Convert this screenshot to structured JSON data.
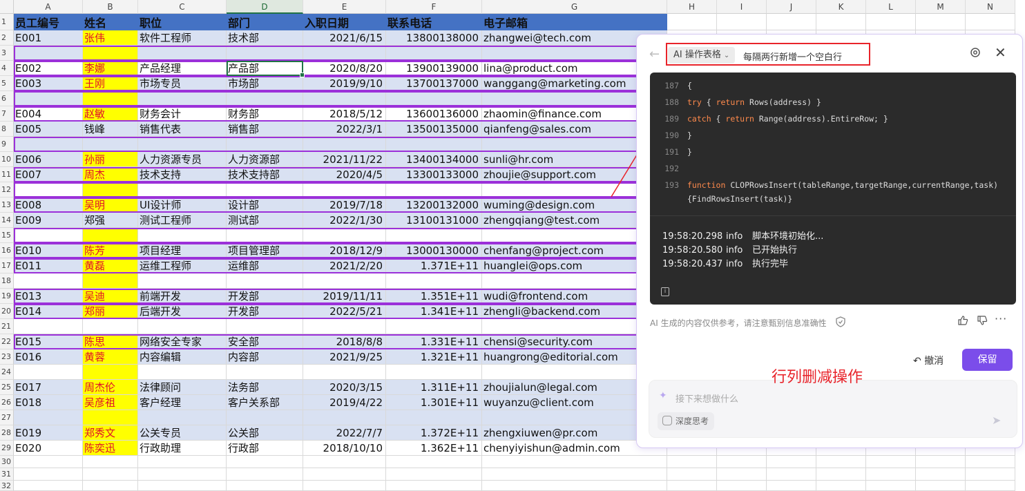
{
  "columns": [
    "A",
    "B",
    "C",
    "D",
    "E",
    "F",
    "G",
    "H",
    "I",
    "J",
    "K",
    "L",
    "M",
    "N"
  ],
  "row_numbers": [
    "1",
    "2",
    "3",
    "4",
    "5",
    "6",
    "7",
    "8",
    "9",
    "10",
    "11",
    "12",
    "13",
    "14",
    "15",
    "16",
    "17",
    "18",
    "19",
    "20",
    "21",
    "22",
    "23",
    "24",
    "25",
    "26",
    "27",
    "28",
    "29",
    "30",
    "31",
    "32"
  ],
  "table": {
    "headers": [
      "员工编号",
      "姓名",
      "职位",
      "部门",
      "入职日期",
      "联系电话",
      "电子邮箱"
    ],
    "rows": [
      [
        "E001",
        "张伟",
        "软件工程师",
        "技术部",
        "2021/6/15",
        "13800138000",
        "zhangwei@tech.com"
      ],
      [
        "",
        "",
        "",
        "",
        "",
        "",
        ""
      ],
      [
        "E002",
        "李娜",
        "产品经理",
        "产品部",
        "2020/8/20",
        "13900139000",
        "lina@product.com"
      ],
      [
        "E003",
        "王刚",
        "市场专员",
        "市场部",
        "2019/9/10",
        "13700137000",
        "wanggang@marketing.com"
      ],
      [
        "",
        "",
        "",
        "",
        "",
        "",
        ""
      ],
      [
        "E004",
        "赵敏",
        "财务会计",
        "财务部",
        "2018/5/12",
        "13600136000",
        "zhaomin@finance.com"
      ],
      [
        "E005",
        "钱峰",
        "销售代表",
        "销售部",
        "2022/3/1",
        "13500135000",
        "qianfeng@sales.com"
      ],
      [
        "",
        "",
        "",
        "",
        "",
        "",
        ""
      ],
      [
        "E006",
        "孙丽",
        "人力资源专员",
        "人力资源部",
        "2021/11/22",
        "13400134000",
        "sunli@hr.com"
      ],
      [
        "E007",
        "周杰",
        "技术支持",
        "技术支持部",
        "2020/4/5",
        "13300133000",
        "zhoujie@support.com"
      ],
      [
        "",
        "",
        "",
        "",
        "",
        "",
        ""
      ],
      [
        "E008",
        "吴明",
        "UI设计师",
        "设计部",
        "2019/7/18",
        "13200132000",
        "wuming@design.com"
      ],
      [
        "E009",
        "郑强",
        "测试工程师",
        "测试部",
        "2022/1/30",
        "13100131000",
        "zhengqiang@test.com"
      ],
      [
        "",
        "",
        "",
        "",
        "",
        "",
        ""
      ],
      [
        "E010",
        "陈芳",
        "项目经理",
        "项目管理部",
        "2018/12/9",
        "13000130000",
        "chenfang@project.com"
      ],
      [
        "E011",
        "黄磊",
        "运维工程师",
        "运维部",
        "2021/2/20",
        "1.371E+11",
        "huanglei@ops.com"
      ],
      [
        "",
        "",
        "",
        "",
        "",
        "",
        ""
      ],
      [
        "E013",
        "吴迪",
        "前端开发",
        "开发部",
        "2019/11/11",
        "1.351E+11",
        "wudi@frontend.com"
      ],
      [
        "E014",
        "郑丽",
        "后端开发",
        "开发部",
        "2022/5/21",
        "1.341E+11",
        "zhengli@backend.com"
      ],
      [
        "",
        "",
        "",
        "",
        "",
        "",
        ""
      ],
      [
        "E015",
        "陈思",
        "网络安全专家",
        "安全部",
        "2018/8/8",
        "1.331E+11",
        "chensi@security.com"
      ],
      [
        "E016",
        "黄蓉",
        "内容编辑",
        "内容部",
        "2021/9/25",
        "1.321E+11",
        "huangrong@editorial.com"
      ],
      [
        "",
        "",
        "",
        "",
        "",
        "",
        ""
      ],
      [
        "E017",
        "周杰伦",
        "法律顾问",
        "法务部",
        "2020/3/15",
        "1.311E+11",
        "zhoujialun@legal.com"
      ],
      [
        "E018",
        "吴彦祖",
        "客户经理",
        "客户关系部",
        "2019/4/22",
        "1.301E+11",
        "wuyanzu@client.com"
      ],
      [
        "",
        "",
        "",
        "",
        "",
        "",
        ""
      ],
      [
        "E019",
        "郑秀文",
        "公关专员",
        "公关部",
        "2022/7/7",
        "1.372E+11",
        "zhengxiuwen@pr.com"
      ],
      [
        "E020",
        "陈奕迅",
        "行政助理",
        "行政部",
        "2018/10/10",
        "1.362E+11",
        "chenyiyishun@admin.com"
      ]
    ]
  },
  "colors": {
    "header_fill": "#4472c4",
    "band_fill": "#d9e1f2",
    "highlight_fill": "#ffff00",
    "highlight_text": "#e0102a",
    "outline": "#9b30d9",
    "accent": "#7b4dea",
    "annotation": "#e8232a"
  },
  "panel": {
    "mode_label": "AI 操作表格",
    "prompt": "每隔两行新增一个空白行",
    "code_lines": [
      {
        "n": "187",
        "t": "{"
      },
      {
        "n": "188",
        "t": "try { return Rows(address) }"
      },
      {
        "n": "189",
        "t": "catch { return Range(address).EntireRow; }"
      },
      {
        "n": "190",
        "t": "}"
      },
      {
        "n": "191",
        "t": "}"
      },
      {
        "n": "192",
        "t": ""
      },
      {
        "n": "193",
        "t": "function CLOPRowsInsert(tableRange,targetRange,currentRange,task)"
      },
      {
        "n": "",
        "t": "{FindRowsInsert(task)}"
      }
    ],
    "logs": [
      {
        "time": "19:58:20.298",
        "level": "info",
        "msg": "脚本环境初始化..."
      },
      {
        "time": "19:58:20.580",
        "level": "info",
        "msg": "已开始执行"
      },
      {
        "time": "19:58:20.437",
        "level": "info",
        "msg": "执行完毕"
      }
    ],
    "disclaimer": "AI 生成的内容仅供参考，请注意甄别信息准确性",
    "undo_label": "撤消",
    "keep_label": "保留",
    "input_placeholder": "接下来想做什么",
    "deep_think_label": "深度思考"
  },
  "annotation_text": "行列删减操作",
  "icons": [
    "back-arrow-icon",
    "chevron-down-icon",
    "gear-icon",
    "close-icon",
    "info-icon",
    "shield-icon",
    "thumbs-up-icon",
    "thumbs-down-icon",
    "more-icon",
    "undo-icon",
    "sparkle-icon",
    "brain-icon",
    "send-icon"
  ]
}
